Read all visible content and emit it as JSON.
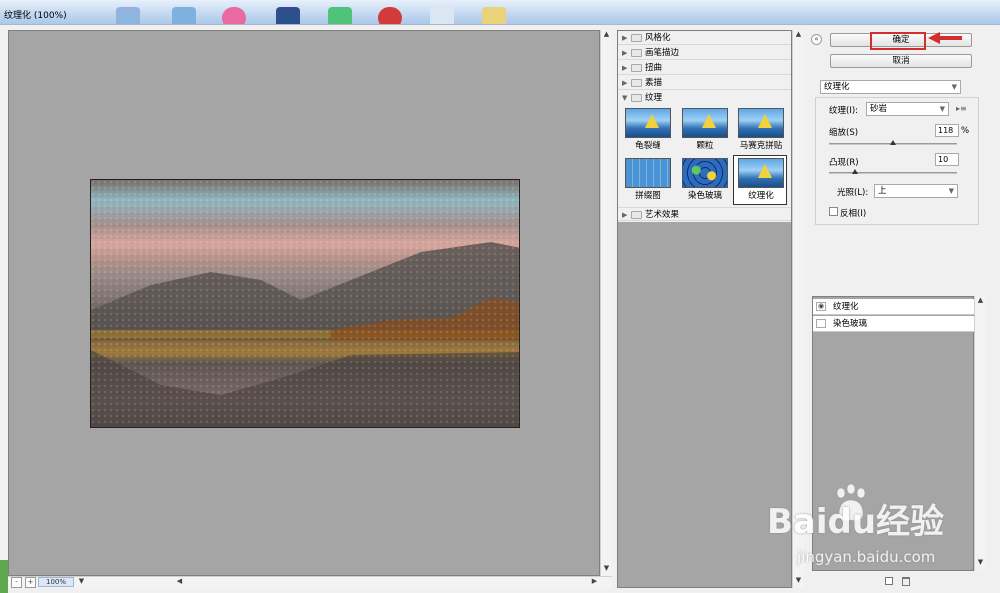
{
  "window": {
    "title": "纹理化 (100%)"
  },
  "preview": {
    "zoom": "100%",
    "zoom_out": "-",
    "zoom_in": "+"
  },
  "filter_gallery": {
    "categories_top": [
      "风格化",
      "画笔描边",
      "扭曲",
      "素描"
    ],
    "open_category": "纹理",
    "thumbnails": [
      {
        "label": "龟裂缝",
        "icon": "craquelure-thumb"
      },
      {
        "label": "颗粒",
        "icon": "grain-thumb"
      },
      {
        "label": "马赛克拼贴",
        "icon": "mosaic-tiles-thumb"
      },
      {
        "label": "拼缀图",
        "icon": "patchwork-thumb"
      },
      {
        "label": "染色玻璃",
        "icon": "stained-glass-thumb"
      },
      {
        "label": "纹理化",
        "icon": "texturizer-thumb",
        "selected": true
      }
    ],
    "categories_bottom": [
      "艺术效果"
    ]
  },
  "buttons": {
    "ok": "确定",
    "cancel": "取消"
  },
  "settings": {
    "filter_select": "纹理化",
    "texture_label": "纹理(I):",
    "texture_value": "砂岩",
    "scaling_label": "缩放(S)",
    "scaling_value": "118",
    "scaling_unit": "%",
    "scaling_level": 0.5,
    "relief_label": "凸现(R)",
    "relief_value": "10",
    "relief_level": 0.2,
    "light_label": "光照(L):",
    "light_value": "上",
    "invert_label": "反相(I)",
    "invert_checked": false
  },
  "layers": [
    {
      "name": "纹理化",
      "visible": true
    },
    {
      "name": "染色玻璃",
      "visible": false
    }
  ],
  "watermark": {
    "brand": "Baidu经验",
    "url": "jingyan.baidu.com"
  },
  "colors": {
    "highlight": "#d32d2d",
    "canvas_gray": "#a5a5a5"
  }
}
